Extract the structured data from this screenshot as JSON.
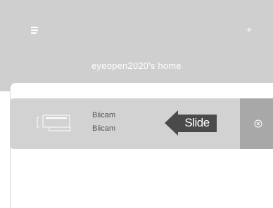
{
  "header": {
    "menu_icon": "menu-icon",
    "add_icon": "plus-icon",
    "title": "eyeopen2020's home",
    "background": "#cfcfcf"
  },
  "devices": [
    {
      "name": "Biicam",
      "model": "Biicam",
      "icon": "camera-device-icon"
    }
  ],
  "hint": {
    "label": "Slide",
    "icon": "left-arrow-icon",
    "color": "#4a4a4a"
  },
  "row_actions": {
    "delete_icon": "close-circle-icon",
    "background": "#a8a8a8"
  }
}
